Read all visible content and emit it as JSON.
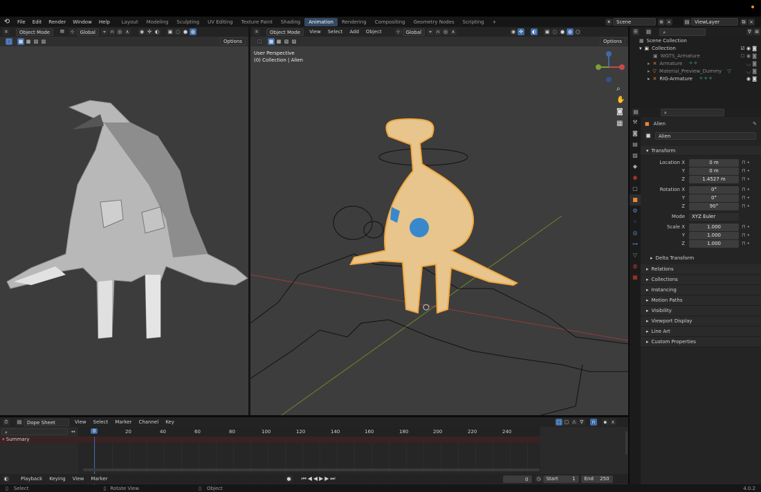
{
  "menu": [
    "File",
    "Edit",
    "Render",
    "Window",
    "Help"
  ],
  "workspaces": [
    {
      "label": "Layout"
    },
    {
      "label": "Modeling"
    },
    {
      "label": "Sculpting"
    },
    {
      "label": "UV Editing"
    },
    {
      "label": "Texture Paint"
    },
    {
      "label": "Shading"
    },
    {
      "label": "Animation",
      "active": true
    },
    {
      "label": "Rendering"
    },
    {
      "label": "Compositing"
    },
    {
      "label": "Geometry Nodes"
    },
    {
      "label": "Scripting"
    }
  ],
  "add_workspace": "+",
  "scene": {
    "label": "Scene",
    "view_layer": "ViewLayer"
  },
  "left_view": {
    "mode": "Object Mode",
    "orientation": "Global",
    "options": "Options"
  },
  "main_view": {
    "mode": "Object Mode",
    "menus": [
      "View",
      "Select",
      "Add",
      "Object"
    ],
    "orientation": "Global",
    "options": "Options",
    "overlay_line1": "User Perspective",
    "overlay_line2": "(0) Collection | Alien"
  },
  "outliner": {
    "root": "Scene Collection",
    "items": [
      {
        "label": "Collection",
        "color": "#d8d8d8"
      },
      {
        "label": "WGTS_Armature",
        "color": "#8a8a8a"
      },
      {
        "label": "Armature",
        "color": "#8a8a8a"
      },
      {
        "label": "Material_Preview_Dummy",
        "color": "#8a8a8a"
      },
      {
        "label": "RIG-Armature",
        "color": "#d8d8d8"
      }
    ]
  },
  "properties": {
    "object_name": "Alien",
    "data_name": "Alien",
    "transform": "Transform",
    "location": {
      "label": "Location X",
      "x": "0 m",
      "y": "0 m",
      "z": "1.4527 m"
    },
    "rotation": {
      "label": "Rotation X",
      "x": "0°",
      "y": "0°",
      "z": "90°"
    },
    "mode": {
      "label": "Mode",
      "value": "XYZ Euler"
    },
    "scale": {
      "label": "Scale X",
      "x": "1.000",
      "y": "1.000",
      "z": "1.000"
    },
    "axis_y": "Y",
    "axis_z": "Z",
    "delta": "Delta Transform",
    "panels": [
      "Relations",
      "Collections",
      "Instancing",
      "Motion Paths",
      "Visibility",
      "Viewport Display",
      "Line Art",
      "Custom Properties"
    ]
  },
  "dopesheet": {
    "mode": "Dope Sheet",
    "menus": [
      "View",
      "Select",
      "Marker",
      "Channel",
      "Key"
    ],
    "summary": "Summary",
    "ticks": [
      "0",
      "20",
      "40",
      "60",
      "80",
      "100",
      "120",
      "140",
      "160",
      "180",
      "200",
      "220",
      "240"
    ],
    "frame_tick": "0",
    "ends": "↔"
  },
  "timeline": {
    "menus": [
      "Playback",
      "Keying",
      "View",
      "Marker"
    ],
    "current": "0",
    "start_label": "Start",
    "start": "1",
    "end_label": "End",
    "end": "250"
  },
  "status": {
    "select": "Select",
    "rotate": "Rotate View",
    "object": "Object",
    "version": "4.0.2"
  },
  "colors": {
    "accent": "#3f6ba6",
    "selected": "#f2a73d",
    "object_fill": "#e7c58c"
  }
}
